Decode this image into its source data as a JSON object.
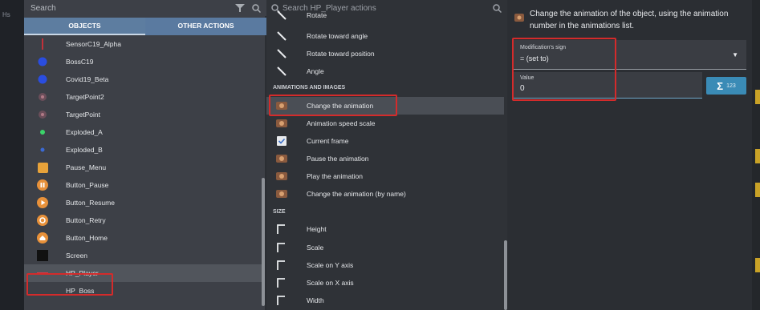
{
  "left_panel": {
    "search_placeholder": "Search",
    "tabs": [
      {
        "label": "OBJECTS"
      },
      {
        "label": "OTHER ACTIONS"
      }
    ],
    "objects": [
      {
        "label": "SensorC19_Alpha",
        "icon": "line-sensor-icon"
      },
      {
        "label": "BossC19",
        "icon": "blue-orb-icon"
      },
      {
        "label": "Covid19_Beta",
        "icon": "blue-orb-icon"
      },
      {
        "label": "TargetPoint2",
        "icon": "target-icon"
      },
      {
        "label": "TargetPoint",
        "icon": "target-icon"
      },
      {
        "label": "Exploded_A",
        "icon": "green-dot-icon"
      },
      {
        "label": "Exploded_B",
        "icon": "blue-dot-icon"
      },
      {
        "label": "Pause_Menu",
        "icon": "orange-panel-icon"
      },
      {
        "label": "Button_Pause",
        "icon": "pause-icon"
      },
      {
        "label": "Button_Resume",
        "icon": "play-icon"
      },
      {
        "label": "Button_Retry",
        "icon": "retry-icon"
      },
      {
        "label": "Button_Home",
        "icon": "home-icon"
      },
      {
        "label": "Screen",
        "icon": "black-square-icon"
      },
      {
        "label": "HP_Player",
        "icon": "red-bar-icon"
      },
      {
        "label": "HP_Boss",
        "icon": "none"
      }
    ]
  },
  "middle_panel": {
    "search_placeholder": "Search HP_Player actions",
    "items": [
      {
        "type": "item",
        "label": "Rotate",
        "icon": "rotate-icon"
      },
      {
        "type": "item",
        "label": "Rotate toward angle",
        "icon": "rotate-icon"
      },
      {
        "type": "item",
        "label": "Rotate toward position",
        "icon": "rotate-icon"
      },
      {
        "type": "item",
        "label": "Angle",
        "icon": "rotate-icon"
      },
      {
        "type": "section",
        "label": "ANIMATIONS AND IMAGES"
      },
      {
        "type": "item",
        "label": "Change the animation",
        "icon": "animation-icon"
      },
      {
        "type": "item",
        "label": "Animation speed scale",
        "icon": "animation-icon"
      },
      {
        "type": "item",
        "label": "Current frame",
        "icon": "frame-icon"
      },
      {
        "type": "item",
        "label": "Pause the animation",
        "icon": "animation-icon"
      },
      {
        "type": "item",
        "label": "Play the animation",
        "icon": "animation-icon"
      },
      {
        "type": "item",
        "label": "Change the animation (by name)",
        "icon": "animation-icon"
      },
      {
        "type": "section",
        "label": "SIZE"
      },
      {
        "type": "item",
        "label": "Height",
        "icon": "resize-icon"
      },
      {
        "type": "item",
        "label": "Scale",
        "icon": "resize-icon"
      },
      {
        "type": "item",
        "label": "Scale on Y axis",
        "icon": "resize-icon"
      },
      {
        "type": "item",
        "label": "Scale on X axis",
        "icon": "resize-icon"
      },
      {
        "type": "item",
        "label": "Width",
        "icon": "resize-icon"
      }
    ]
  },
  "right_panel": {
    "description": "Change the animation of the object, using the animation number in the animations list.",
    "modification_label": "Modification's sign",
    "modification_value": "= (set to)",
    "value_label": "Value",
    "value": "0",
    "expression_button_symbol": "Σ",
    "expression_button_text": "123"
  },
  "colors": {
    "accent_tab": "#5d7da0",
    "highlight_box": "#d42b2b",
    "expression_button": "#3a8bb6"
  }
}
